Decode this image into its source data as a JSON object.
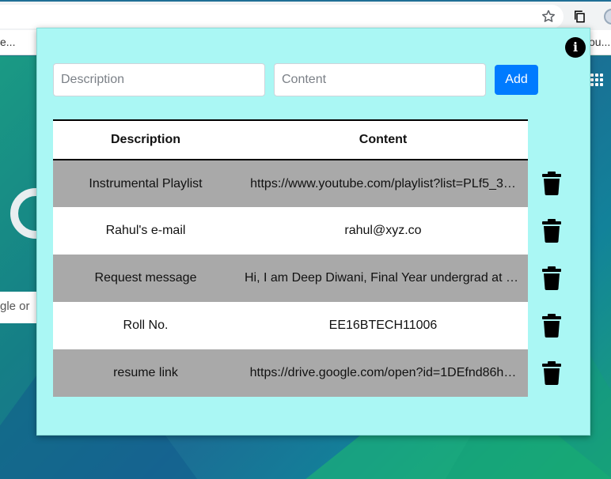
{
  "browser": {
    "bookmark_left": "e...",
    "bookmark_right": "ou..."
  },
  "ntp": {
    "search_placeholder": "gle or"
  },
  "form": {
    "description_placeholder": "Description",
    "content_placeholder": "Content",
    "add_label": "Add"
  },
  "table": {
    "headers": [
      "Description",
      "Content"
    ],
    "rows": [
      {
        "description": "Instrumental Playlist",
        "content": "https://www.youtube.com/playlist?list=PLf5_3…"
      },
      {
        "description": "Rahul's e-mail",
        "content": "rahul@xyz.co"
      },
      {
        "description": "Request message",
        "content": "Hi, I am Deep Diwani, Final Year undergrad at II…"
      },
      {
        "description": "Roll No.",
        "content": "EE16BTECH11006"
      },
      {
        "description": "resume link",
        "content": "https://drive.google.com/open?id=1DEfnd86h…"
      }
    ]
  },
  "colors": {
    "popup_bg": "#aaf7f4",
    "accent": "#007bff",
    "row_stripe": "#a9a9a9"
  },
  "icons": {
    "info": "info-icon",
    "delete": "trash-icon"
  }
}
